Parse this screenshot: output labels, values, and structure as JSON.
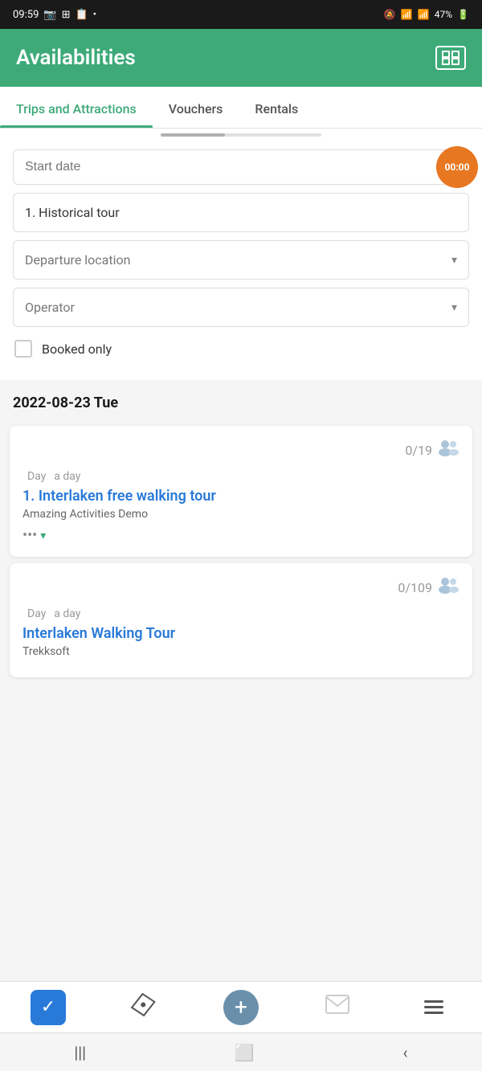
{
  "statusBar": {
    "time": "09:59",
    "battery": "47%",
    "icons": [
      "camera",
      "grid",
      "notification"
    ]
  },
  "header": {
    "title": "Availabilities",
    "iconLabel": "expand-icon"
  },
  "tabs": [
    {
      "id": "trips",
      "label": "Trips and Attractions",
      "active": true
    },
    {
      "id": "vouchers",
      "label": "Vouchers",
      "active": false
    },
    {
      "id": "rentals",
      "label": "Rentals",
      "active": false
    }
  ],
  "filters": {
    "startDatePlaceholder": "Start date",
    "timerValue": "00:00",
    "tourName": "1. Historical tour",
    "departureLocationPlaceholder": "Departure location",
    "operatorPlaceholder": "Operator",
    "bookedOnlyLabel": "Booked only"
  },
  "dateSection": {
    "dateHeading": "2022-08-23 Tue"
  },
  "tripCards": [
    {
      "id": "card1",
      "capacity": "0/19",
      "dayLabel": "Day",
      "daySubLabel": "a day",
      "tourName": "1. Interlaken free walking tour",
      "operator": "Amazing Activities Demo",
      "hasMore": true
    },
    {
      "id": "card2",
      "capacity": "0/109",
      "dayLabel": "Day",
      "daySubLabel": "a day",
      "tourName": "Interlaken Walking Tour",
      "operator": "Trekksoft",
      "hasMore": false
    }
  ],
  "bottomNav": [
    {
      "id": "check",
      "iconType": "check",
      "label": ""
    },
    {
      "id": "ticket",
      "iconType": "ticket",
      "label": ""
    },
    {
      "id": "add",
      "iconType": "plus",
      "label": ""
    },
    {
      "id": "mail",
      "iconType": "mail",
      "label": ""
    },
    {
      "id": "menu",
      "iconType": "menu",
      "label": ""
    }
  ],
  "androidNav": {
    "backLabel": "back",
    "homeLabel": "home",
    "recentLabel": "recent"
  }
}
